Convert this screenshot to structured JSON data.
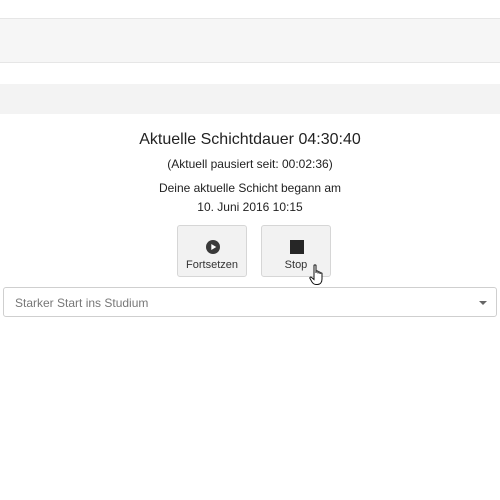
{
  "shift": {
    "duration_label": "Aktuelle Schichtdauer 04:30:40",
    "paused_label": "(Aktuell pausiert seit: 00:02:36)",
    "began_label": "Deine aktuelle Schicht begann am",
    "began_date": "10. Juni 2016 10:15"
  },
  "actions": {
    "resume": {
      "label": "Fortsetzen",
      "icon": "play-icon"
    },
    "stop": {
      "label": "Stop",
      "icon": "stop-icon"
    }
  },
  "project_select": {
    "value": "Starker Start ins Studium"
  }
}
